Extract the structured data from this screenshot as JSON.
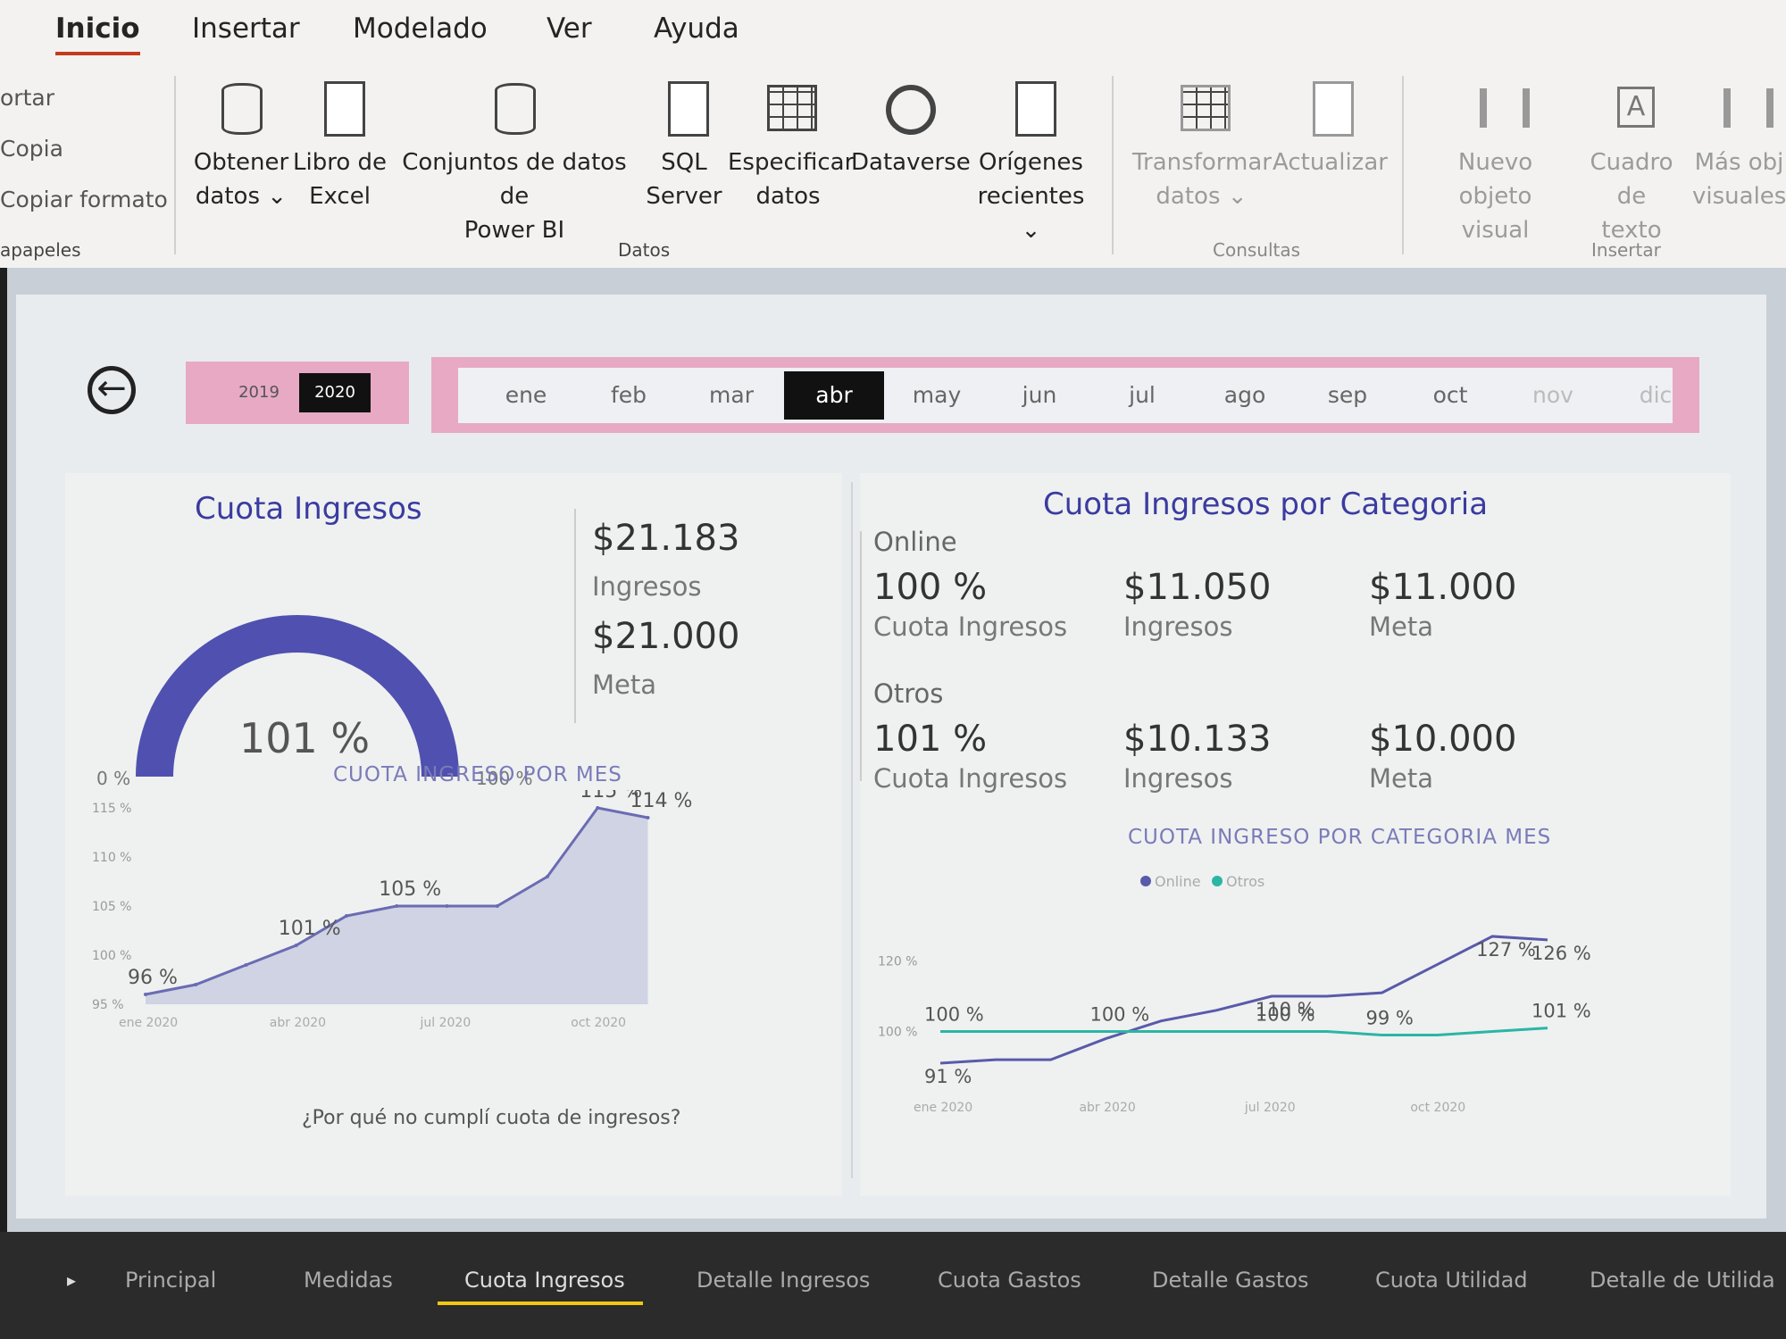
{
  "ribbon": {
    "tabs": [
      "Inicio",
      "Insertar",
      "Modelado",
      "Ver",
      "Ayuda"
    ],
    "clipboard": {
      "items": [
        "ortar",
        "Copia",
        "Copiar formato"
      ],
      "group": "apapeles"
    },
    "datos": {
      "group": "Datos",
      "buttons": [
        {
          "l1": "Obtener",
          "l2": "datos ⌄",
          "icon": "database-table-icon"
        },
        {
          "l1": "Libro de",
          "l2": "Excel",
          "icon": "excel-icon"
        },
        {
          "l1": "Conjuntos de datos de",
          "l2": "Power BI",
          "icon": "datasets-icon"
        },
        {
          "l1": "SQL",
          "l2": "Server",
          "icon": "sql-server-icon"
        },
        {
          "l1": "Especificar",
          "l2": "datos",
          "icon": "enter-data-icon"
        },
        {
          "l1": "Dataverse",
          "l2": "",
          "icon": "dataverse-icon"
        },
        {
          "l1": "Orígenes",
          "l2": "recientes ⌄",
          "icon": "recent-sources-icon"
        }
      ]
    },
    "consultas": {
      "group": "Consultas",
      "buttons": [
        {
          "l1": "Transformar",
          "l2": "datos ⌄",
          "icon": "transform-data-icon"
        },
        {
          "l1": "Actualizar",
          "l2": "",
          "icon": "refresh-icon"
        }
      ]
    },
    "insertar": {
      "group": "Insertar",
      "buttons": [
        {
          "l1": "Nuevo objeto",
          "l2": "visual",
          "icon": "new-visual-icon"
        },
        {
          "l1": "Cuadro de",
          "l2": "texto",
          "icon": "text-box-icon"
        },
        {
          "l1": "Más obj",
          "l2": "visuales",
          "icon": "more-visuals-icon"
        }
      ]
    }
  },
  "filters": {
    "years": [
      "2019",
      "2020"
    ],
    "selected_year": "2020",
    "months": [
      "ene",
      "feb",
      "mar",
      "abr",
      "may",
      "jun",
      "jul",
      "ago",
      "sep",
      "oct",
      "nov",
      "dic"
    ],
    "selected_month": "abr"
  },
  "cuota": {
    "title": "Cuota Ingresos",
    "gauge_value": "101 %",
    "gauge_fraction": 1.01,
    "gauge_min": "0 %",
    "gauge_max": "100 %",
    "ingresos_value": "$21.183",
    "ingresos_label": "Ingresos",
    "meta_value": "$21.000",
    "meta_label": "Meta"
  },
  "categoria": {
    "title": "Cuota Ingresos por Categoria",
    "online": {
      "name": "Online",
      "cuota": "100 %",
      "cuota_label": "Cuota Ingresos",
      "ingresos": "$11.050",
      "ingresos_label": "Ingresos",
      "meta": "$11.000",
      "meta_label": "Meta"
    },
    "otros": {
      "name": "Otros",
      "cuota": "101 %",
      "cuota_label": "Cuota Ingresos",
      "ingresos": "$10.133",
      "ingresos_label": "Ingresos",
      "meta": "$10.000",
      "meta_label": "Meta"
    }
  },
  "question": "¿Por qué no cumplí cuota de ingresos?",
  "page_tabs": [
    "Principal",
    "Medidas",
    "Cuota Ingresos",
    "Detalle Ingresos",
    "Cuota Gastos",
    "Detalle Gastos",
    "Cuota Utilidad",
    "Detalle de Utilida"
  ],
  "active_page": "Cuota Ingresos",
  "chart_data": [
    {
      "type": "area",
      "title": "CUOTA INGRESO POR MES",
      "x": [
        "ene 2020",
        "feb 2020",
        "mar 2020",
        "abr 2020",
        "may 2020",
        "jun 2020",
        "jul 2020",
        "ago 2020",
        "sep 2020",
        "oct 2020",
        "nov 2020"
      ],
      "x_ticks": [
        "ene 2020",
        "abr 2020",
        "jul 2020",
        "oct 2020"
      ],
      "values": [
        96,
        97,
        99,
        101,
        104,
        105,
        105,
        105,
        108,
        115,
        114
      ],
      "labels": [
        "96 %",
        "",
        "",
        "101 %",
        "",
        "105 %",
        "",
        "",
        "",
        "115 %",
        "114 %"
      ],
      "y_ticks": [
        "95 %",
        "100 %",
        "105 %",
        "110 %",
        "115 %"
      ],
      "ylim": [
        95,
        115
      ],
      "color": "#6b6bb3"
    },
    {
      "type": "line",
      "title": "CUOTA INGRESO POR CATEGORIA MES",
      "legend": [
        "Online",
        "Otros"
      ],
      "legend_position": "top",
      "x": [
        "ene 2020",
        "feb 2020",
        "mar 2020",
        "abr 2020",
        "may 2020",
        "jun 2020",
        "jul 2020",
        "ago 2020",
        "sep 2020",
        "oct 2020",
        "nov 2020",
        "dic 2020"
      ],
      "x_ticks": [
        "ene 2020",
        "abr 2020",
        "jul 2020",
        "oct 2020"
      ],
      "y_ticks": [
        "100 %",
        "120 %"
      ],
      "ylim": [
        90,
        128
      ],
      "series": [
        {
          "name": "Online",
          "color": "#5a5aaa",
          "values": [
            91,
            92,
            92,
            98,
            103,
            106,
            110,
            110,
            111,
            119,
            127,
            126
          ],
          "labels": [
            "91 %",
            "",
            "",
            "",
            "",
            "",
            "110 %",
            "",
            "",
            "",
            "127 %",
            "126 %"
          ]
        },
        {
          "name": "Otros",
          "color": "#2cb5a5",
          "values": [
            100,
            100,
            100,
            100,
            100,
            100,
            100,
            100,
            99,
            99,
            100,
            101
          ],
          "labels": [
            "100 %",
            "",
            "",
            "100 %",
            "",
            "",
            "100 %",
            "",
            "99 %",
            "",
            "",
            "101 %"
          ]
        }
      ]
    }
  ]
}
